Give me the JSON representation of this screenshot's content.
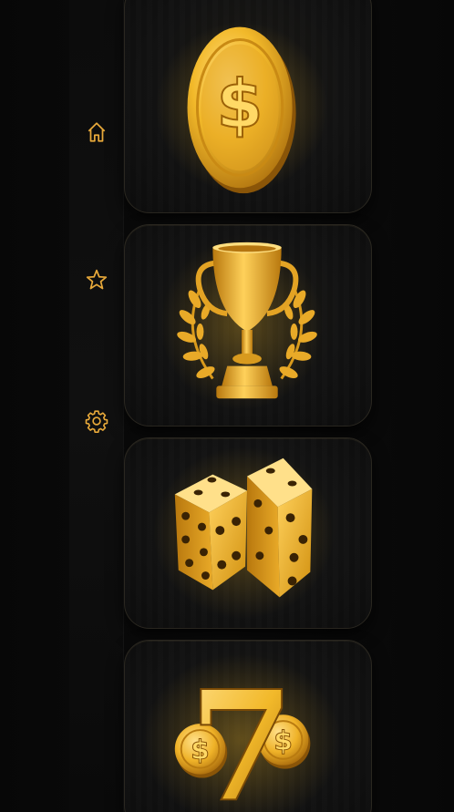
{
  "theme": {
    "gold": "#f2b92a",
    "gold_light": "#ffd966",
    "gold_dark": "#a86a0c",
    "background": "#050505"
  },
  "sidebar": {
    "items": [
      {
        "icon": "home-icon"
      },
      {
        "icon": "star-icon"
      },
      {
        "icon": "gear-icon"
      }
    ]
  },
  "tiles": [
    {
      "icon": "dollar-coin-icon"
    },
    {
      "icon": "trophy-icon"
    },
    {
      "icon": "dice-icon"
    },
    {
      "icon": "lucky-seven-icon"
    }
  ],
  "seven_text": "7",
  "coin_symbol": "$"
}
